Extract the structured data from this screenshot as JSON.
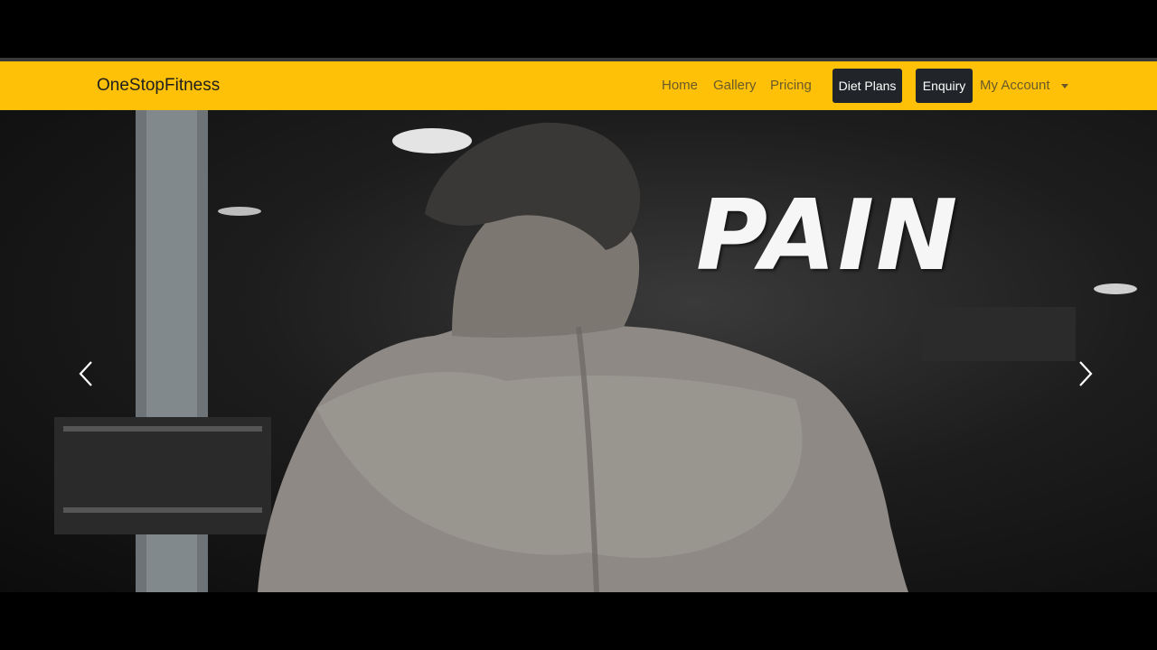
{
  "navbar": {
    "brand": "OneStopFitness",
    "links": [
      {
        "label": "Home"
      },
      {
        "label": "Gallery"
      },
      {
        "label": "Pricing"
      }
    ],
    "buttons": [
      {
        "label": "Diet Plans"
      },
      {
        "label": "Enquiry"
      }
    ],
    "account_menu": {
      "label": "My Account",
      "icon": "caret-down-icon"
    },
    "background_color": "#fec107",
    "button_color": "#212529"
  },
  "carousel": {
    "heading": "PAIN",
    "prev_icon": "chevron-left-icon",
    "next_icon": "chevron-right-icon"
  }
}
